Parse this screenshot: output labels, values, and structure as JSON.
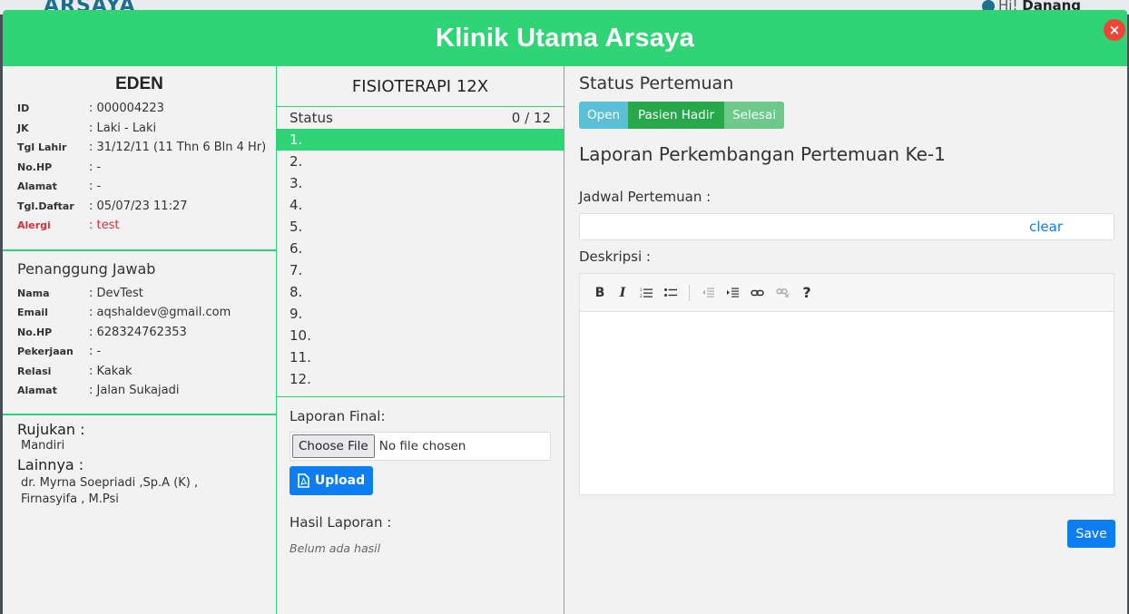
{
  "background": {
    "logo": "ARSAYA",
    "greeting": "Hi!",
    "user": "Danang"
  },
  "modal": {
    "title": "Klinik Utama Arsaya",
    "close_label": "×"
  },
  "patient": {
    "name": "EDEN",
    "fields": [
      {
        "label": "ID",
        "value": ": 000004223"
      },
      {
        "label": "JK",
        "value": ": Laki - Laki"
      },
      {
        "label": "Tgl Lahir",
        "value": ": 31/12/11 (11 Thn 6 Bln 4 Hr)"
      },
      {
        "label": "No.HP",
        "value": ": -"
      },
      {
        "label": "Alamat",
        "value": ": -"
      },
      {
        "label": "Tgl.Daftar",
        "value": ": 05/07/23 11:27"
      },
      {
        "label": "Alergi",
        "value": ": test"
      }
    ]
  },
  "guardian": {
    "title": "Penanggung Jawab",
    "fields": [
      {
        "label": "Nama",
        "value": ": DevTest"
      },
      {
        "label": "Email",
        "value": ": aqshaldev@gmail.com"
      },
      {
        "label": "No.HP",
        "value": ": 628324762353"
      },
      {
        "label": "Pekerjaan",
        "value": ": -"
      },
      {
        "label": "Relasi",
        "value": ": Kakak"
      },
      {
        "label": "Alamat",
        "value": ": Jalan Sukajadi"
      }
    ]
  },
  "referral": {
    "rujukan_label": "Rujukan :",
    "rujukan_value": "Mandiri",
    "lainnya_label": "Lainnya :",
    "lainnya_value_1": "dr. Myrna Soepriadi ,Sp.A (K) ,",
    "lainnya_value_2": "Firnasyifa , M.Psi"
  },
  "program": {
    "title": "FISIOTERAPI 12X",
    "status_label": "Status",
    "status_count": "0 / 12",
    "meetings": [
      "1.",
      "2.",
      "3.",
      "4.",
      "5.",
      "6.",
      "7.",
      "8.",
      "9.",
      "10.",
      "11.",
      "12."
    ],
    "final_report_label": "Laporan Final:",
    "choose_file": "Choose File",
    "no_file": "No file chosen",
    "upload_label": "Upload",
    "result_label": "Hasil Laporan :",
    "no_result": "Belum ada hasil"
  },
  "meeting": {
    "status_title": "Status Pertemuan",
    "buttons": {
      "open": "Open",
      "present": "Pasien Hadir",
      "done": "Selesai"
    },
    "report_title": "Laporan Perkembangan Pertemuan Ke-1",
    "schedule_label": "Jadwal Pertemuan :",
    "schedule_value": "",
    "clear_label": "clear",
    "description_label": "Deskripsi :",
    "toolbar": {
      "bold": "B",
      "italic": "I",
      "help": "?"
    },
    "save_label": "Save"
  },
  "colors": {
    "header_green": "#2fd575",
    "primary_blue": "#0d7ef2",
    "open": "#5bc0d5",
    "present": "#27a84a",
    "done": "#6cc98a",
    "alert_red": "#d6303a",
    "close_red": "#f04438"
  }
}
